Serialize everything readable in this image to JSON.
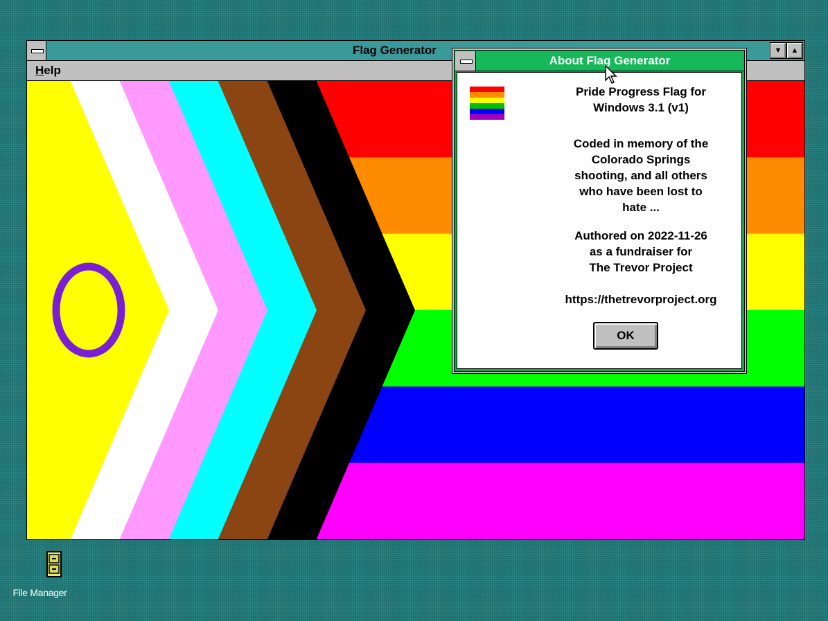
{
  "window": {
    "title": "Flag Generator",
    "menu": [
      {
        "label": "Help"
      }
    ],
    "controls": {
      "minimize": "▼",
      "maximize": "▲"
    }
  },
  "flag": {
    "stripes": [
      "#ff0000",
      "#ff8c00",
      "#ffff00",
      "#00ff00",
      "#0000ff",
      "#ff00ff"
    ],
    "chevrons": [
      "#000000",
      "#8b4513",
      "#00ffff",
      "#ff99ff",
      "#ffffff",
      "#ffff00"
    ],
    "intersex_ring_color": "#7b1fd6"
  },
  "about_dialog": {
    "title": "About Flag Generator",
    "app_name": "Pride Progress Flag for Windows 3.1 (v1)",
    "app_name_lines": [
      "Pride Progress Flag for",
      "Windows 3.1 (v1)"
    ],
    "dedication_lines": [
      "Coded in memory of the",
      "Colorado Springs",
      "shooting, and all others",
      "who have been lost to",
      "hate ..."
    ],
    "authored_lines": [
      "Authored on 2022-11-26",
      "as a fundraiser for",
      "The Trevor Project"
    ],
    "url": "https://thetrevorproject.org",
    "ok_label": "OK",
    "icon_colors": [
      "#ff0000",
      "#ff8c00",
      "#ffff00",
      "#00c000",
      "#0000ff",
      "#a000c0"
    ]
  },
  "desktop": {
    "icons": [
      {
        "label": "File Manager",
        "icon": "file-cabinet-icon"
      }
    ]
  },
  "colors": {
    "desktop": "#1e6e6e",
    "window_title": "#3a9a9a",
    "dialog_title": "#16b85a"
  }
}
